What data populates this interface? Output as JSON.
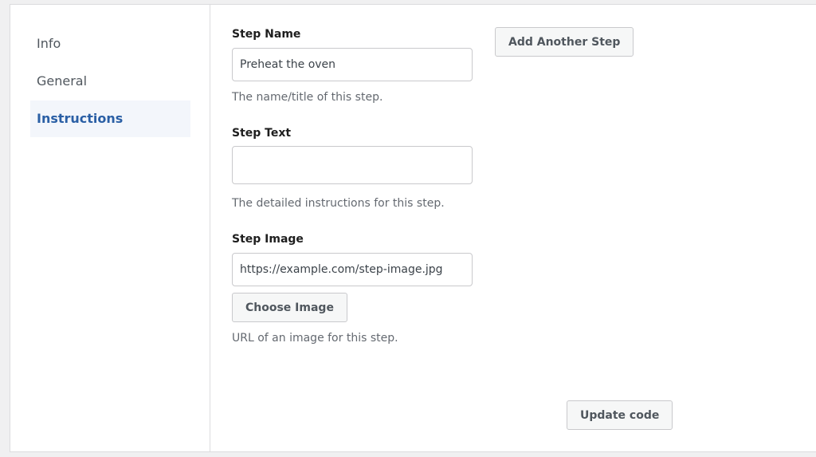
{
  "sidebar": {
    "items": [
      {
        "label": "Info",
        "active": false
      },
      {
        "label": "General",
        "active": false
      },
      {
        "label": "Instructions",
        "active": true
      }
    ]
  },
  "form": {
    "step_name": {
      "label": "Step Name",
      "value": "Preheat the oven",
      "help": "The name/title of this step."
    },
    "step_text": {
      "label": "Step Text",
      "value": "",
      "help": "The detailed instructions for this step."
    },
    "step_image": {
      "label": "Step Image",
      "value": "https://example.com/step-image.jpg",
      "choose_label": "Choose Image",
      "help": "URL of an image for this step."
    }
  },
  "actions": {
    "add_step_label": "Add Another Step",
    "update_label": "Update code"
  }
}
